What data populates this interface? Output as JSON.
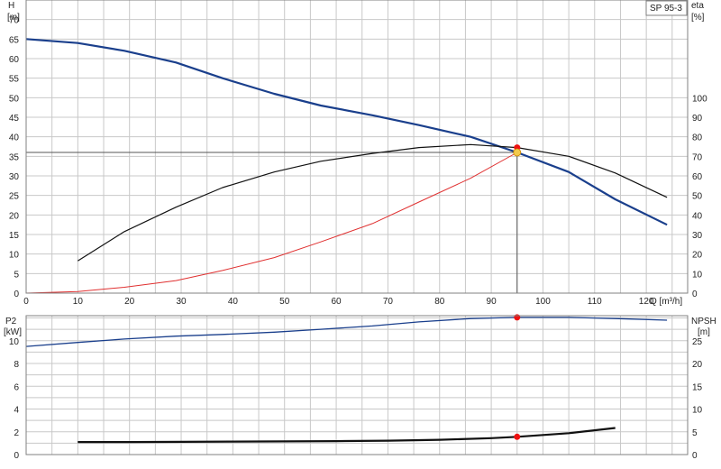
{
  "model_label": "SP 95-3",
  "chart_data": [
    {
      "type": "line",
      "panel": "top",
      "axis_labels": {
        "y_left_name": "H",
        "y_left_unit": "[m]",
        "y_right_name": "eta",
        "y_right_unit": "[%]",
        "x": "Q [m³/h]"
      },
      "xlim": [
        0,
        128
      ],
      "x_ticks": [
        0,
        10,
        20,
        30,
        40,
        50,
        60,
        70,
        80,
        90,
        100,
        110,
        120
      ],
      "ylim_left": [
        0,
        75
      ],
      "y_left_ticks": [
        0,
        5,
        10,
        15,
        20,
        25,
        30,
        35,
        40,
        45,
        50,
        55,
        60,
        65,
        70
      ],
      "ylim_right": [
        0,
        150
      ],
      "y_right_ticks": [
        0,
        10,
        20,
        30,
        40,
        50,
        60,
        70,
        80,
        90,
        100
      ],
      "grid": true,
      "series": [
        {
          "axis": "left",
          "color": "#1a3f8c",
          "x": [
            0,
            10,
            19,
            29,
            38,
            48,
            57,
            67,
            76,
            86,
            95,
            105,
            114,
            124
          ],
          "y": [
            65,
            64,
            62,
            59,
            55,
            51,
            48,
            45.5,
            43,
            40,
            36,
            31,
            24,
            17.5
          ]
        },
        {
          "axis": "right",
          "color": "#111111",
          "x": [
            10,
            19,
            29,
            38,
            48,
            57,
            67,
            76,
            86,
            95,
            105,
            114,
            124
          ],
          "y": [
            16.5,
            31.5,
            44,
            54,
            62,
            67.5,
            71.5,
            74.5,
            76,
            74.5,
            70,
            61.5,
            49
          ]
        },
        {
          "axis": "left",
          "color": "#e03030",
          "x": [
            0,
            10,
            19,
            29,
            38,
            48,
            57,
            67,
            76,
            86,
            95
          ],
          "y": [
            0,
            0.4,
            1.5,
            3.2,
            5.8,
            9.1,
            13.1,
            17.8,
            23.3,
            29.4,
            36
          ]
        }
      ],
      "duty_point": {
        "x": 95,
        "y": 36
      },
      "eta_point": {
        "x": 95,
        "y": 74.5
      }
    },
    {
      "type": "line",
      "panel": "bottom",
      "axis_labels": {
        "y_left_name": "P2",
        "y_left_unit": "[kW]",
        "y_right_name": "NPSH",
        "y_right_unit": "[m]"
      },
      "xlim": [
        0,
        128
      ],
      "ylim_left": [
        0,
        12.2
      ],
      "y_left_ticks": [
        0,
        2,
        4,
        6,
        8,
        10
      ],
      "ylim_right": [
        0,
        30.5
      ],
      "y_right_ticks": [
        0,
        5,
        10,
        15,
        20,
        25
      ],
      "grid": true,
      "series": [
        {
          "axis": "left",
          "color": "#1a3f8c",
          "x": [
            0,
            10,
            19,
            29,
            38,
            48,
            57,
            67,
            76,
            86,
            95,
            105,
            114,
            124
          ],
          "y": [
            9.5,
            9.85,
            10.15,
            10.4,
            10.55,
            10.75,
            11.0,
            11.3,
            11.65,
            11.95,
            12.05,
            12.05,
            11.95,
            11.8
          ]
        },
        {
          "axis": "right",
          "color": "#111111",
          "x": [
            10,
            20,
            30,
            40,
            50,
            60,
            70,
            80,
            90,
            95,
            105,
            114
          ],
          "y": [
            2.75,
            2.75,
            2.8,
            2.85,
            2.9,
            2.95,
            3.05,
            3.25,
            3.6,
            3.9,
            4.7,
            5.85
          ]
        }
      ],
      "p2_point": {
        "x": 95,
        "y": 12.05
      },
      "npsh_point": {
        "x": 95,
        "y": 3.9
      }
    }
  ]
}
